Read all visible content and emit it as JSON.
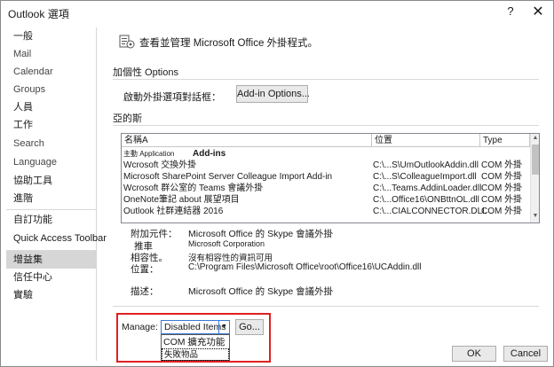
{
  "window": {
    "title": "Outlook 選項",
    "help_glyph": "?",
    "close_glyph": "✕"
  },
  "sidebar": {
    "items": [
      {
        "label": "一般",
        "selected": false
      },
      {
        "label": "Mail",
        "selected": false
      },
      {
        "label": "Calendar",
        "selected": false
      },
      {
        "label": "Groups",
        "selected": false
      },
      {
        "label": "人員",
        "selected": false
      },
      {
        "label": "工作",
        "selected": false
      },
      {
        "label": "Search",
        "selected": false
      },
      {
        "label": "Language",
        "selected": false
      },
      {
        "label": "協助工具",
        "selected": false
      },
      {
        "label": "進階",
        "selected": false
      },
      {
        "label": "自訂功能",
        "selected": false
      },
      {
        "label": "Quick Access Toolbar",
        "selected": false
      },
      {
        "label": "增益集",
        "selected": true
      },
      {
        "label": "信任中心",
        "selected": false
      },
      {
        "label": "實驗",
        "selected": false
      }
    ]
  },
  "header": {
    "text": "查看並管理 Microsoft Office 外掛程式。"
  },
  "options_section": {
    "title": "加個性 Options",
    "launch_label": "啟動外掛選項對話框：",
    "button_label": "Add-in Options..."
  },
  "addins_section": {
    "title": "亞的斯"
  },
  "list": {
    "columns": [
      "名稱A",
      "位置",
      "Type"
    ],
    "group_title_prefix": "主動 Application",
    "group_title": "Add-ins",
    "rows": [
      {
        "name": "Wcrosoft 交換外掛",
        "location": "C:\\...S\\UmOutlookAddin.dll",
        "type": "COM 外掛"
      },
      {
        "name": "Microsoft SharePoint Server Colleague Import Add-in",
        "location": "C:\\...S\\ColleagueImport.dll",
        "type": "COM 外掛"
      },
      {
        "name": "Wcrosoft 群公室的 Teams 會議外掛",
        "location": "C:\\...Teams.AddinLoader.dll",
        "type": "COM 外掛"
      },
      {
        "name": "OneNote筆記 about 展望項目",
        "location": "C:\\...Office16\\ONBttnOL.dll",
        "type": "COM 外掛"
      },
      {
        "name": "Outlook 社群連結器 2016",
        "location": "C:\\...CIALCONNECTOR.DLL",
        "type": "COM 外掛"
      }
    ]
  },
  "details": {
    "addin_label": "附加元件：",
    "addin_value": "Microsoft Office 的 Skype 會議外掛",
    "publisher_label": "推車",
    "publisher_value": "Microsoft Corporation",
    "compat_label": "相容性。",
    "compat_value": "沒有相容性的資訊可用",
    "location_label": "位置：",
    "location_value": "C:\\Program Files\\Microsoft Office\\root\\Office16\\UCAddin.dll",
    "desc_label": "描述：",
    "desc_value": "Microsoft Office 的 Skype 會議外掛"
  },
  "manage": {
    "label": "Manage:",
    "selected": "Disabled Items",
    "go_label": "Go...",
    "options": [
      "COM 擴充功能",
      "失敗物品"
    ]
  },
  "footer": {
    "ok_label": "OK",
    "cancel_label": "Cancel"
  },
  "colors": {
    "highlight": "#e02020",
    "selected_bg": "#d6d6d6",
    "accent_border": "#3a78d6"
  }
}
